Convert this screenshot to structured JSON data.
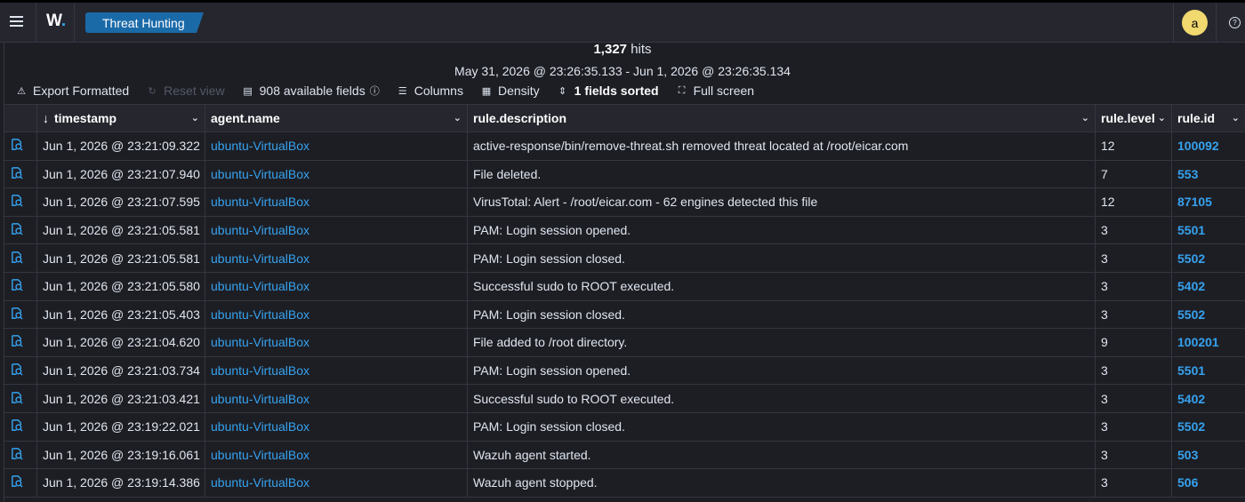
{
  "header": {
    "logo_text": "W",
    "breadcrumb": "Threat Hunting",
    "avatar_letter": "a",
    "help_glyph": "?"
  },
  "summary": {
    "hits_count": "1,327",
    "hits_label": "hits",
    "date_range": "May 31, 2026 @ 23:26:35.133 - Jun 1, 2026 @ 23:26:35.134"
  },
  "toolbar": {
    "export": "Export Formatted",
    "reset": "Reset view",
    "fields": "908 available fields",
    "columns": "Columns",
    "density": "Density",
    "sorted": "1 fields sorted",
    "fullscreen": "Full screen"
  },
  "table": {
    "headers": {
      "timestamp": "timestamp",
      "agent": "agent.name",
      "description": "rule.description",
      "level": "rule.level",
      "id": "rule.id"
    },
    "rows": [
      {
        "timestamp": "Jun 1, 2026 @ 23:21:09.322",
        "agent": "ubuntu-VirtualBox",
        "description": "active-response/bin/remove-threat.sh removed threat located at /root/eicar.com",
        "level": "12",
        "id": "100092"
      },
      {
        "timestamp": "Jun 1, 2026 @ 23:21:07.940",
        "agent": "ubuntu-VirtualBox",
        "description": "File deleted.",
        "level": "7",
        "id": "553"
      },
      {
        "timestamp": "Jun 1, 2026 @ 23:21:07.595",
        "agent": "ubuntu-VirtualBox",
        "description": "VirusTotal: Alert - /root/eicar.com - 62 engines detected this file",
        "level": "12",
        "id": "87105"
      },
      {
        "timestamp": "Jun 1, 2026 @ 23:21:05.581",
        "agent": "ubuntu-VirtualBox",
        "description": "PAM: Login session opened.",
        "level": "3",
        "id": "5501"
      },
      {
        "timestamp": "Jun 1, 2026 @ 23:21:05.581",
        "agent": "ubuntu-VirtualBox",
        "description": "PAM: Login session closed.",
        "level": "3",
        "id": "5502"
      },
      {
        "timestamp": "Jun 1, 2026 @ 23:21:05.580",
        "agent": "ubuntu-VirtualBox",
        "description": "Successful sudo to ROOT executed.",
        "level": "3",
        "id": "5402"
      },
      {
        "timestamp": "Jun 1, 2026 @ 23:21:05.403",
        "agent": "ubuntu-VirtualBox",
        "description": "PAM: Login session closed.",
        "level": "3",
        "id": "5502"
      },
      {
        "timestamp": "Jun 1, 2026 @ 23:21:04.620",
        "agent": "ubuntu-VirtualBox",
        "description": "File added to /root directory.",
        "level": "9",
        "id": "100201"
      },
      {
        "timestamp": "Jun 1, 2026 @ 23:21:03.734",
        "agent": "ubuntu-VirtualBox",
        "description": "PAM: Login session opened.",
        "level": "3",
        "id": "5501"
      },
      {
        "timestamp": "Jun 1, 2026 @ 23:21:03.421",
        "agent": "ubuntu-VirtualBox",
        "description": "Successful sudo to ROOT executed.",
        "level": "3",
        "id": "5402"
      },
      {
        "timestamp": "Jun 1, 2026 @ 23:19:22.021",
        "agent": "ubuntu-VirtualBox",
        "description": "PAM: Login session closed.",
        "level": "3",
        "id": "5502"
      },
      {
        "timestamp": "Jun 1, 2026 @ 23:19:16.061",
        "agent": "ubuntu-VirtualBox",
        "description": "Wazuh agent started.",
        "level": "3",
        "id": "503"
      },
      {
        "timestamp": "Jun 1, 2026 @ 23:19:14.386",
        "agent": "ubuntu-VirtualBox",
        "description": "Wazuh agent stopped.",
        "level": "3",
        "id": "506"
      }
    ]
  },
  "colors": {
    "background": "#1d1e24",
    "link": "#36a2ef",
    "breadcrumb": "#1b6aa8",
    "avatar": "#f1d86f"
  },
  "icons": {
    "menu": "hamburger-icon",
    "export": "export-icon",
    "reset": "refresh-icon",
    "fields": "fields-icon",
    "columns": "list-icon",
    "density": "density-icon",
    "sort": "sort-icon",
    "fullscreen": "fullscreen-icon",
    "inspect": "inspect-document-icon"
  }
}
